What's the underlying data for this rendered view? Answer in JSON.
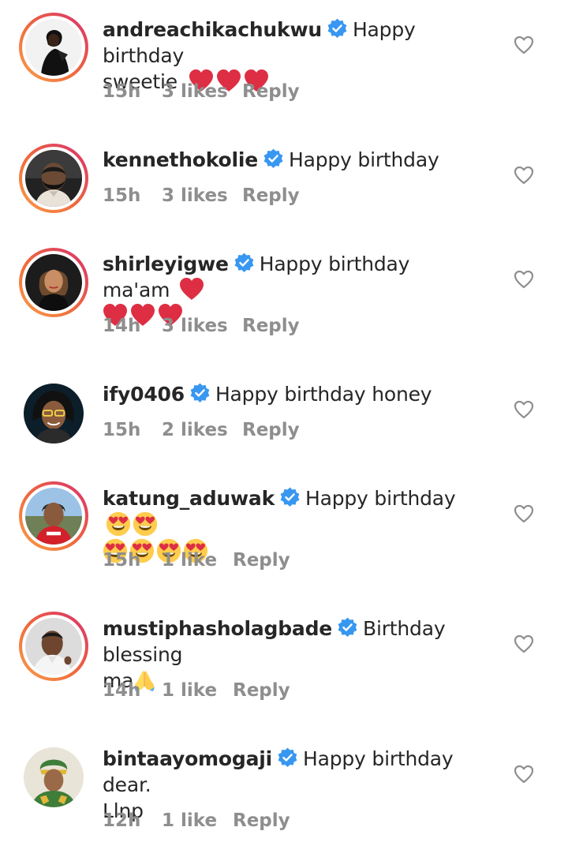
{
  "comments": [
    {
      "username": "andreachikachukwu",
      "verified": true,
      "text_line1": "Happy birthday",
      "text_line2": "sweetie",
      "emojis": [
        "heart",
        "heart",
        "heart"
      ],
      "time": "15h",
      "likes": "3 likes",
      "reply": "Reply",
      "story_ring": true
    },
    {
      "username": "kennethokolie",
      "verified": true,
      "text": "Happy birthday",
      "time": "15h",
      "likes": "3 likes",
      "reply": "Reply",
      "story_ring": true
    },
    {
      "username": "shirleyigwe",
      "verified": true,
      "text": "Happy birthday ma'am",
      "emojis": [
        "heart",
        "heart",
        "heart",
        "heart"
      ],
      "time": "14h",
      "likes": "3 likes",
      "reply": "Reply",
      "story_ring": true
    },
    {
      "username": "ify0406",
      "verified": true,
      "text": "Happy birthday honey",
      "time": "15h",
      "likes": "2 likes",
      "reply": "Reply",
      "story_ring": false
    },
    {
      "username": "katung_aduwak",
      "verified": true,
      "text": "Happy birthday",
      "emojis": [
        "heart-eyes",
        "heart-eyes",
        "heart-eyes",
        "heart-eyes",
        "heart-eyes",
        "heart-eyes"
      ],
      "time": "15h",
      "likes": "1 like",
      "reply": "Reply",
      "story_ring": true
    },
    {
      "username": "mustiphasholagbade",
      "verified": true,
      "text_line1": "Birthday blessing",
      "text_line2": "ma",
      "emojis": [
        "folded-hands"
      ],
      "time": "14h",
      "likes": "1 like",
      "reply": "Reply",
      "story_ring": true
    },
    {
      "username": "bintaayomogaji",
      "verified": true,
      "text_line1": "Happy birthday dear.",
      "text_line2": "Llnp",
      "time": "12h",
      "likes": "1 like",
      "reply": "Reply",
      "story_ring": false
    }
  ],
  "colors": {
    "username": "#262626",
    "meta": "#8e8e8e",
    "verified_badge": "#3897f0",
    "heart_emoji": "#dd2e44",
    "like_outline": "#8e8e8e"
  },
  "icons": {
    "verified": "verified-badge-icon",
    "like": "heart-outline-icon"
  }
}
